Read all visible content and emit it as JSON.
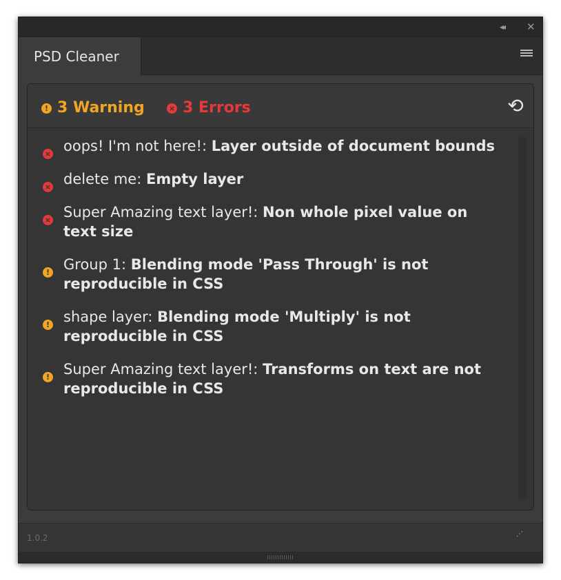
{
  "window": {
    "title": "PSD Cleaner",
    "collapse_icon": "double-chevron-left-icon",
    "close_icon": "close-icon",
    "collapse_glyph": "◂◂",
    "close_glyph": "✕",
    "menu_icon": "hamburger-menu-icon"
  },
  "summary": {
    "warning_label": "3 Warning",
    "error_label": "3 Errors",
    "warning_icon_glyph": "!",
    "error_icon_glyph": "×",
    "refresh_glyph": "⟲",
    "colors": {
      "warning": "#f0a524",
      "error": "#e8393a"
    }
  },
  "issues": [
    {
      "type": "error",
      "icon": "×",
      "layer": "oops! I'm not here!: ",
      "message": "Layer outside of document bounds"
    },
    {
      "type": "error",
      "icon": "×",
      "layer": "delete me: ",
      "message": "Empty layer"
    },
    {
      "type": "error",
      "icon": "×",
      "layer": "Super Amazing text layer!: ",
      "message": "Non whole pixel value on text size"
    },
    {
      "type": "warning",
      "icon": "!",
      "layer": "Group 1: ",
      "message": "Blending mode 'Pass Through' is not reproducible in CSS"
    },
    {
      "type": "warning",
      "icon": "!",
      "layer": "shape layer: ",
      "message": "Blending mode 'Multiply' is not reproducible in CSS"
    },
    {
      "type": "warning",
      "icon": "!",
      "layer": "Super Amazing text layer!: ",
      "message": "Transforms on text are not reproducible in CSS"
    }
  ],
  "footer": {
    "version": "1.0.2",
    "grip_glyph": "⋰"
  }
}
